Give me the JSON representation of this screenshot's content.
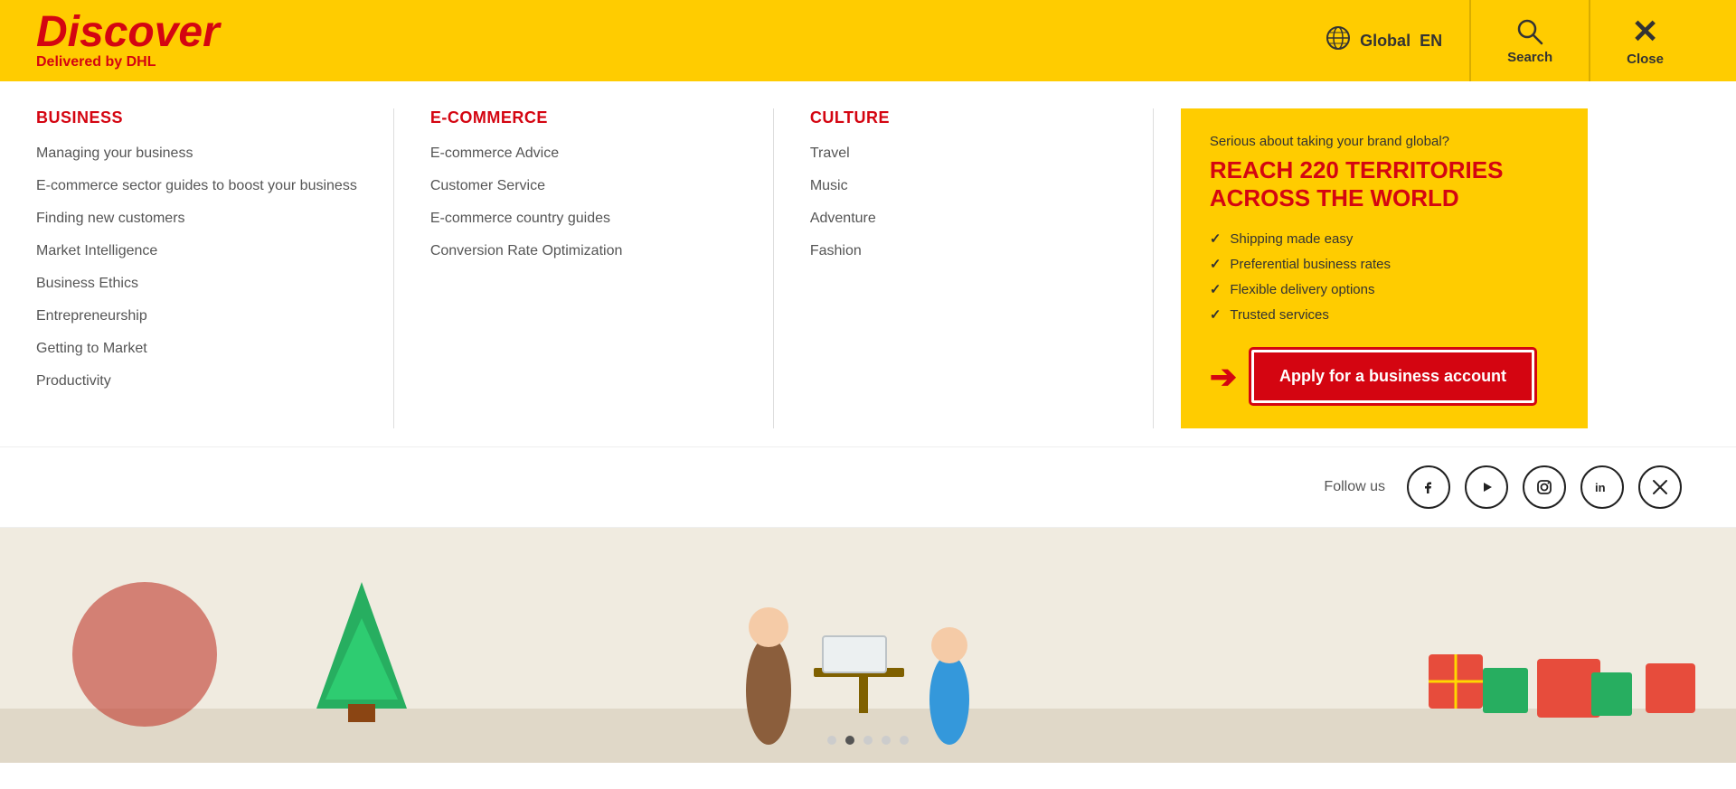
{
  "header": {
    "logo_title": "Discover",
    "logo_sub_text": "Delivered by ",
    "logo_sub_brand": "DHL",
    "region_label": "Global",
    "lang_label": "EN",
    "search_label": "Search",
    "close_label": "Close"
  },
  "nav": {
    "columns": [
      {
        "id": "business",
        "title": "BUSINESS",
        "links": [
          "Managing your business",
          "E-commerce sector guides to boost your business",
          "Finding new customers",
          "Market Intelligence",
          "Business Ethics",
          "Entrepreneurship",
          "Getting to Market",
          "Productivity"
        ]
      },
      {
        "id": "ecommerce",
        "title": "E-COMMERCE",
        "links": [
          "E-commerce Advice",
          "Customer Service",
          "E-commerce country guides",
          "Conversion Rate Optimization"
        ]
      },
      {
        "id": "culture",
        "title": "CULTURE",
        "links": [
          "Travel",
          "Music",
          "Adventure",
          "Fashion"
        ]
      }
    ]
  },
  "promo": {
    "subtitle": "Serious about taking your brand global?",
    "title": "REACH 220 TERRITORIES ACROSS THE WORLD",
    "features": [
      "Shipping made easy",
      "Preferential business rates",
      "Flexible delivery options",
      "Trusted services"
    ],
    "cta_label": "Apply for a business account"
  },
  "social": {
    "follow_text": "Follow us",
    "icons": [
      {
        "name": "facebook",
        "symbol": "f"
      },
      {
        "name": "youtube",
        "symbol": "▶"
      },
      {
        "name": "instagram",
        "symbol": "◉"
      },
      {
        "name": "linkedin",
        "symbol": "in"
      },
      {
        "name": "twitter",
        "symbol": "𝕏"
      }
    ]
  },
  "hero": {
    "dots": [
      false,
      true,
      false,
      false,
      false
    ]
  }
}
